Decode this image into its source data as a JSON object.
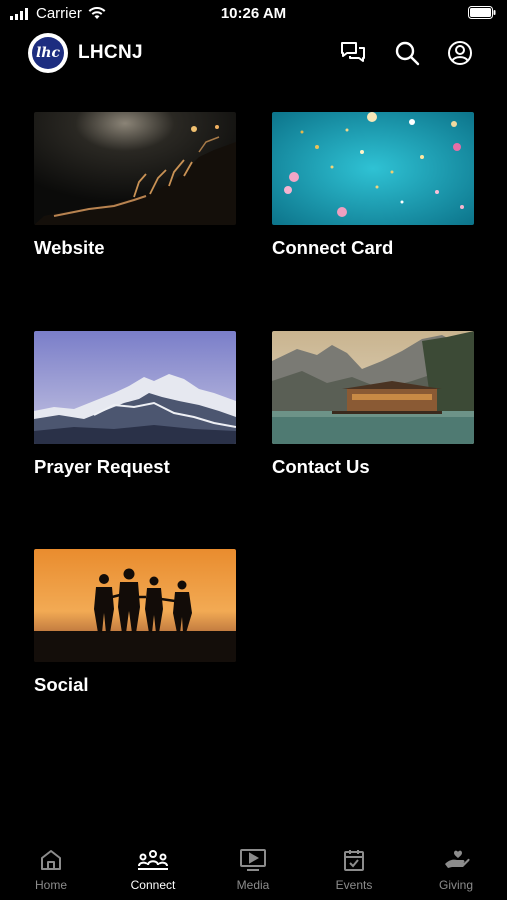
{
  "status_bar": {
    "carrier": "Carrier",
    "time": "10:26 AM"
  },
  "header": {
    "logo_text": "lhc",
    "title": "LHCNJ",
    "icons": [
      "chat-icon",
      "search-icon",
      "account-icon"
    ]
  },
  "cards": [
    {
      "label": "Website",
      "image": "concert-crowd-hands"
    },
    {
      "label": "Connect Card",
      "image": "teal-confetti"
    },
    {
      "label": "Prayer Request",
      "image": "snowy-mountain"
    },
    {
      "label": "Contact Us",
      "image": "lake-cabin-mountains"
    },
    {
      "label": "Social",
      "image": "family-sunset-silhouette"
    }
  ],
  "tabs": [
    {
      "label": "Home",
      "icon": "home-icon",
      "active": false
    },
    {
      "label": "Connect",
      "icon": "people-icon",
      "active": true
    },
    {
      "label": "Media",
      "icon": "media-play-icon",
      "active": false
    },
    {
      "label": "Events",
      "icon": "calendar-check-icon",
      "active": false
    },
    {
      "label": "Giving",
      "icon": "giving-hand-icon",
      "active": false
    }
  ],
  "colors": {
    "background": "#000000",
    "text": "#ffffff",
    "tab_inactive": "#8c8c8c",
    "logo_blue": "#1d2d80"
  }
}
